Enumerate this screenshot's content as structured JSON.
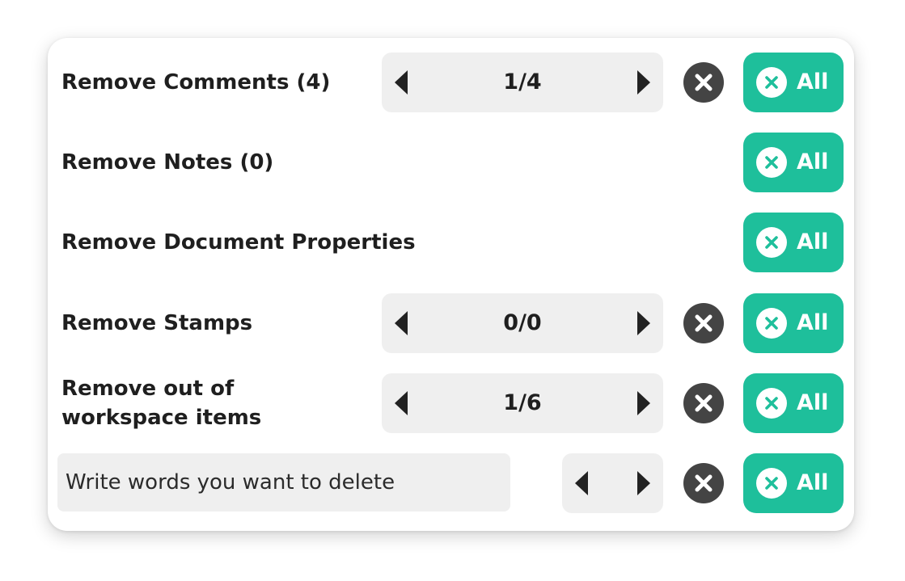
{
  "rows": [
    {
      "label": "Remove Comments (4)",
      "counter": "1/4",
      "all_label": "All"
    },
    {
      "label": "Remove Notes (0)",
      "all_label": "All"
    },
    {
      "label": "Remove Document Properties",
      "all_label": "All"
    },
    {
      "label": "Remove Stamps",
      "counter": "0/0",
      "all_label": "All"
    },
    {
      "label": "Remove out of workspace items",
      "counter": "1/6",
      "all_label": "All"
    }
  ],
  "search": {
    "placeholder": "Write words you want to delete",
    "value": "",
    "all_label": "All"
  },
  "icons": {
    "prev": "caret-left-icon",
    "next": "caret-right-icon",
    "clear": "close-circle-icon",
    "all": "close-circle-icon"
  },
  "colors": {
    "accent": "#1ebf9b",
    "pager_bg": "#efefef",
    "clear_icon": "#444444",
    "text": "#1f1f1f"
  }
}
